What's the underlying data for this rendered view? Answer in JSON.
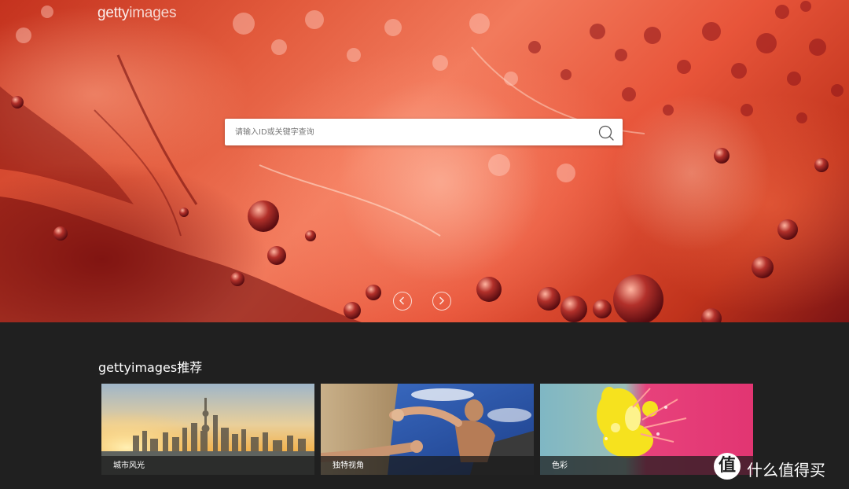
{
  "header": {
    "logo_bold": "getty",
    "logo_light": "images"
  },
  "search": {
    "placeholder": "请输入ID或关键字查询",
    "icon": "search-icon"
  },
  "carousel": {
    "prev_icon": "chevron-left-icon",
    "next_icon": "chevron-right-icon"
  },
  "recommendations": {
    "title": "gettyimages推荐",
    "cards": [
      {
        "caption": "城市风光"
      },
      {
        "caption": "独特视角"
      },
      {
        "caption": "色彩"
      }
    ]
  },
  "watermark": {
    "badge": "值",
    "text": "什么值得买"
  },
  "colors": {
    "page_background": "#202020",
    "hero_red": "#e25a3c",
    "caption_bar": "#191919"
  }
}
